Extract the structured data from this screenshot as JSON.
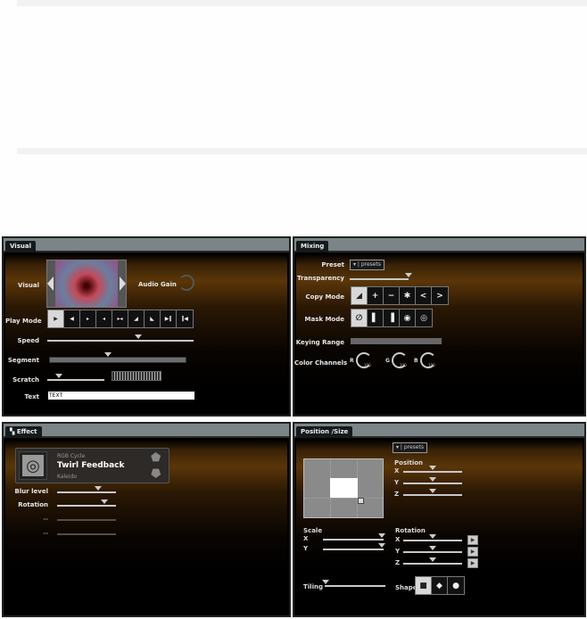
{
  "colors": {
    "panel_bg": "#000000",
    "accent_brown": "#5a3608",
    "tab_bar": "#7b8588"
  },
  "visual": {
    "tab": "Visual",
    "visual_label": "Visual",
    "audio_gain_label": "Audio Gain",
    "play_mode_label": "Play Mode",
    "play_modes": [
      "loop-forward-icon",
      "loop-backward-icon",
      "play-forward-icon",
      "play-backward-icon",
      "ping-pong-icon",
      "ramp-up-icon",
      "ramp-down-icon",
      "play-pause-forward-icon",
      "play-pause-backward-icon"
    ],
    "play_mode_selected": 0,
    "speed_label": "Speed",
    "speed": 0.62,
    "segment_label": "Segment",
    "segment": 0.43,
    "scratch_label": "Scratch",
    "scratch": 0.2,
    "text_label": "Text",
    "text_value": "TEXT"
  },
  "mixing": {
    "tab": "Mixing",
    "preset_label": "Preset",
    "preset_value": "▾ | presets",
    "transparency_label": "Transparency",
    "transparency": 1.0,
    "copy_mode_label": "Copy Mode",
    "copy_modes": [
      "◢",
      "+",
      "−",
      "✱",
      "<",
      ">"
    ],
    "mask_mode_label": "Mask Mode",
    "mask_modes": [
      "∅",
      "▌",
      "▐",
      "◉",
      "◎"
    ],
    "keying_range_label": "Keying Range",
    "color_channels_label": "Color Channels",
    "channels": [
      {
        "name": "R",
        "value": "100"
      },
      {
        "name": "G",
        "value": "100"
      },
      {
        "name": "B",
        "value": "100"
      }
    ]
  },
  "effect": {
    "tab": "Effect",
    "category": "RGB Cycle",
    "name": "Twirl Feedback",
    "next": "Kaleido",
    "params": [
      {
        "label": "Blur level",
        "value": 0.7
      },
      {
        "label": "Rotation",
        "value": 0.8
      },
      {
        "label": "--",
        "value": null
      },
      {
        "label": "--",
        "value": null
      }
    ]
  },
  "position": {
    "tab": "Position /Size",
    "preset_value": "▾ | presets",
    "position_label": "Position",
    "pos": [
      {
        "axis": "X",
        "value": 0.5
      },
      {
        "axis": "Y",
        "value": 0.5
      },
      {
        "axis": "Z",
        "value": 0.5
      }
    ],
    "scale_label": "Scale",
    "scale": [
      {
        "axis": "X",
        "value": 0.97
      },
      {
        "axis": "Y",
        "value": 0.97
      }
    ],
    "rotation_label": "Rotation",
    "rot": [
      {
        "axis": "X",
        "value": 0.5
      },
      {
        "axis": "Y",
        "value": 0.5
      },
      {
        "axis": "Z",
        "value": 0.5
      }
    ],
    "tiling_label": "Tiling",
    "tiling": 0.02,
    "shape_label": "Shape",
    "shapes": [
      "square-icon",
      "cube-icon",
      "sphere-icon"
    ],
    "shape_selected": 0
  }
}
